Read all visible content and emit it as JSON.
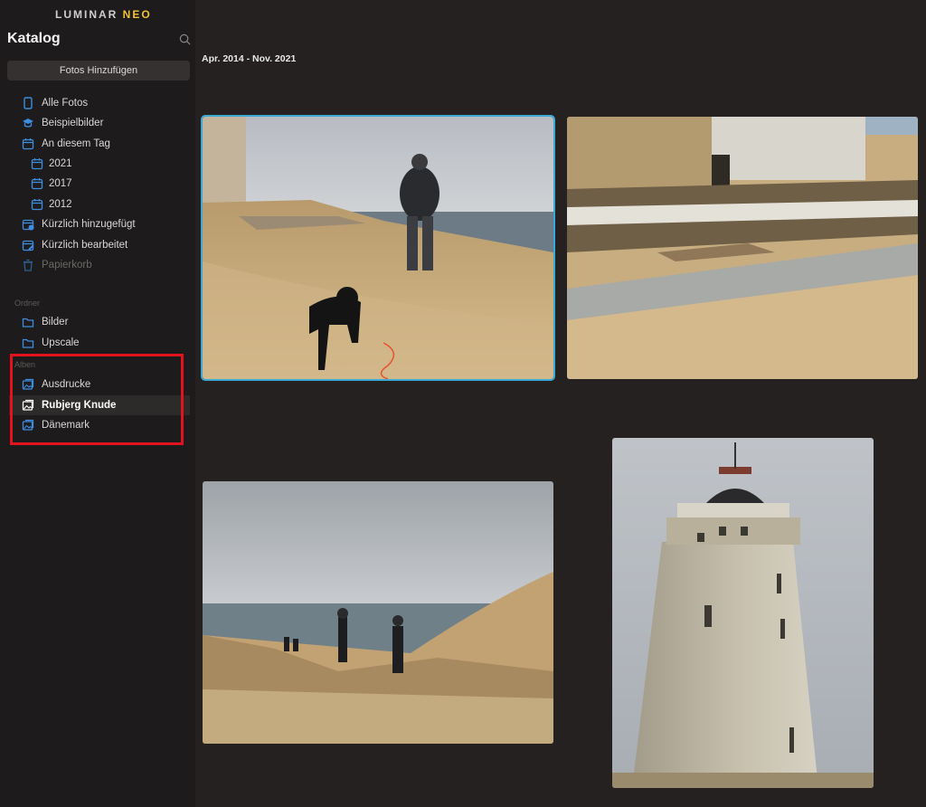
{
  "window": {
    "brand_main": "LUMINAR",
    "brand_accent": "NEO"
  },
  "sidebar": {
    "title": "Katalog",
    "add_button": "Fotos Hinzufügen",
    "library": [
      {
        "label": "Alle Fotos",
        "icon": "phone-icon"
      },
      {
        "label": "Beispielbilder",
        "icon": "graduation-cap-icon"
      },
      {
        "label": "An diesem Tag",
        "icon": "calendar-icon"
      },
      {
        "label": "2021",
        "icon": "calendar-icon"
      },
      {
        "label": "2017",
        "icon": "calendar-icon"
      },
      {
        "label": "2012",
        "icon": "calendar-icon"
      },
      {
        "label": "Kürzlich hinzugefügt",
        "icon": "recent-add-icon"
      },
      {
        "label": "Kürzlich bearbeitet",
        "icon": "recent-edit-icon"
      },
      {
        "label": "Papierkorb",
        "icon": "trash-icon"
      }
    ],
    "folders_label": "Ordner",
    "folders": [
      {
        "label": "Bilder",
        "icon": "folder-icon"
      },
      {
        "label": "Upscale",
        "icon": "folder-icon"
      }
    ],
    "albums_label": "Alben",
    "albums": [
      {
        "label": "Ausdrucke",
        "icon": "album-icon"
      },
      {
        "label": "Rubjerg Knude",
        "icon": "album-icon",
        "active": true
      },
      {
        "label": "Dänemark",
        "icon": "album-icon"
      }
    ]
  },
  "main": {
    "date_range": "Apr. 2014 - Nov. 2021"
  },
  "colors": {
    "accent_blue": "#3d8de0",
    "selection": "#3aa9d6",
    "annotation_red": "#e3121d"
  }
}
